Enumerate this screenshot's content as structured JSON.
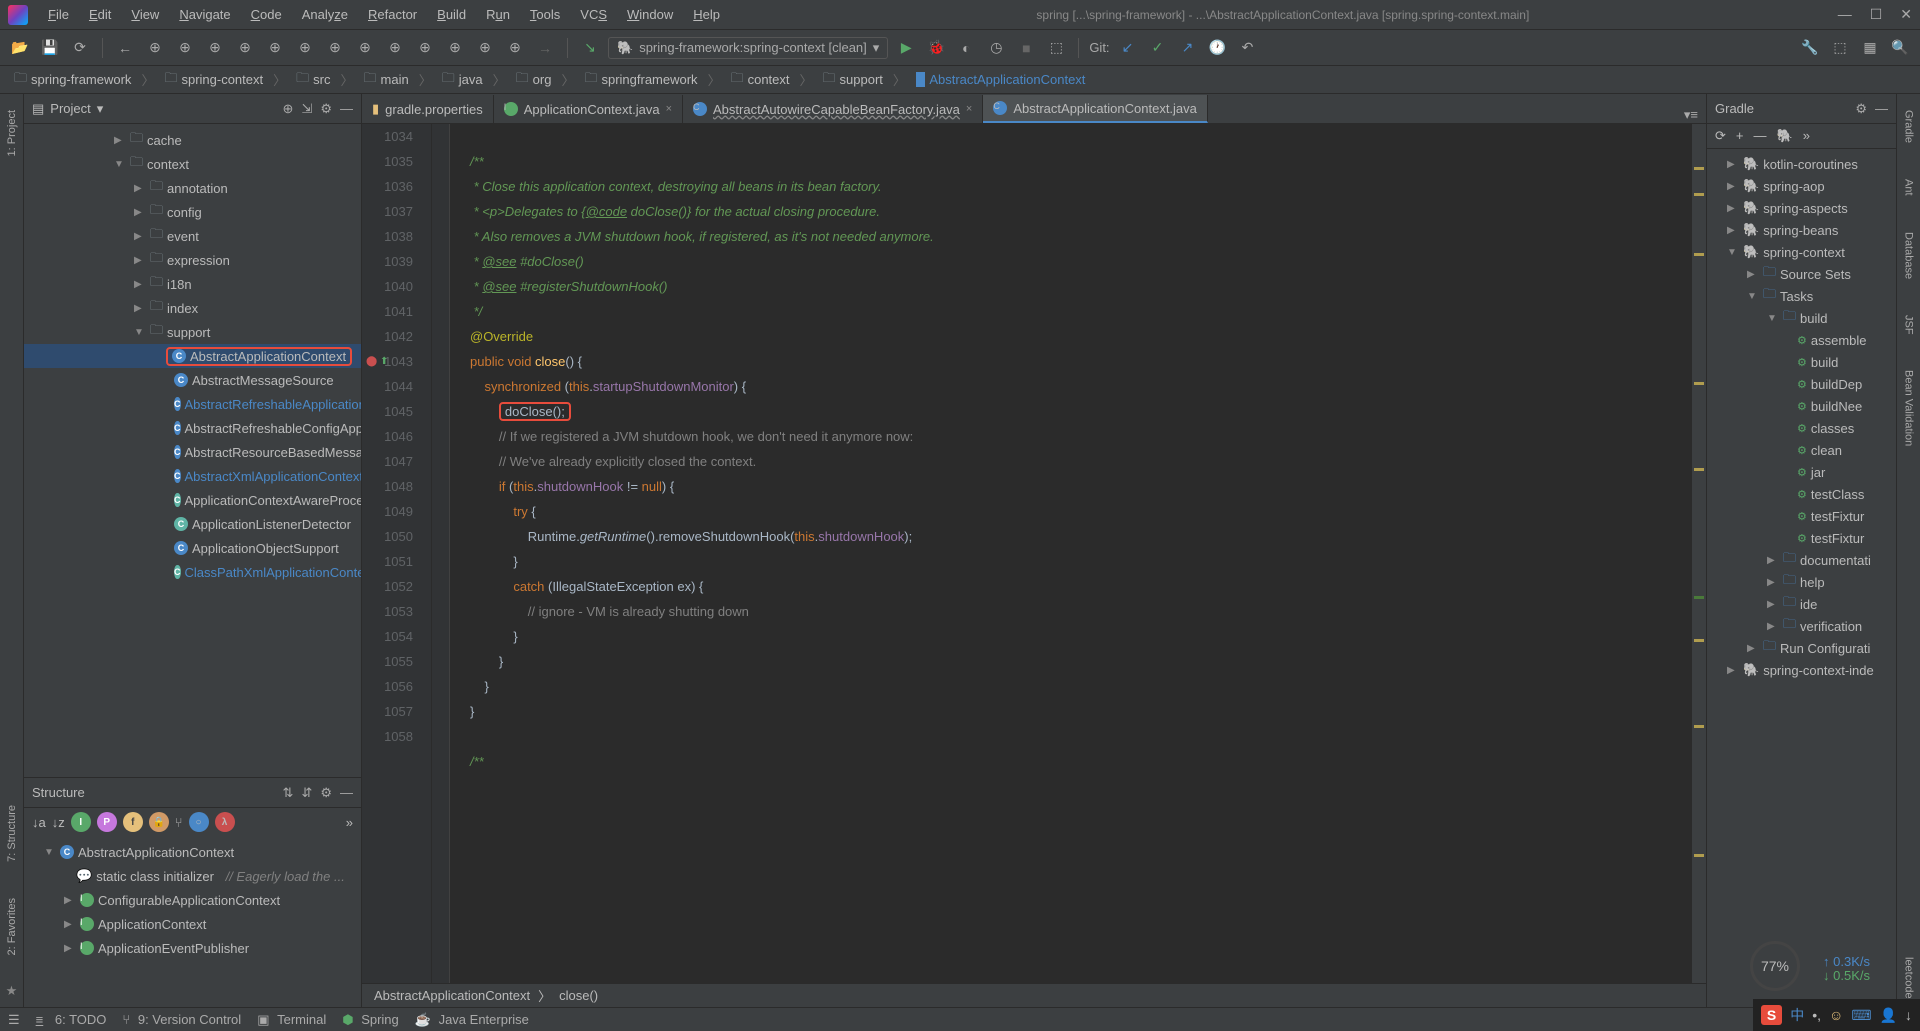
{
  "title": "spring [...\\spring-framework] - ...\\AbstractApplicationContext.java [spring.spring-context.main]",
  "menu": [
    "File",
    "Edit",
    "View",
    "Navigate",
    "Code",
    "Analyze",
    "Refactor",
    "Build",
    "Run",
    "Tools",
    "VCS",
    "Window",
    "Help"
  ],
  "run_config": "spring-framework:spring-context [clean]",
  "git_label": "Git:",
  "breadcrumb": [
    "spring-framework",
    "spring-context",
    "src",
    "main",
    "java",
    "org",
    "springframework",
    "context",
    "support",
    "AbstractApplicationContext"
  ],
  "project_panel_title": "Project",
  "project_tree": {
    "cache": "cache",
    "context": "context",
    "annotation": "annotation",
    "config": "config",
    "event": "event",
    "expression": "expression",
    "i18n": "i18n",
    "index": "index",
    "support": "support",
    "c1": "AbstractApplicationContext",
    "c2": "AbstractMessageSource",
    "c3": "AbstractRefreshableApplicationC",
    "c4": "AbstractRefreshableConfigAppli",
    "c5": "AbstractResourceBasedMessage",
    "c6": "AbstractXmlApplicationContext",
    "c7": "ApplicationContextAwareProces",
    "c8": "ApplicationListenerDetector",
    "c9": "ApplicationObjectSupport",
    "c10": "ClassPathXmlApplicationContex"
  },
  "structure_title": "Structure",
  "structure_items": {
    "s1": "AbstractApplicationContext",
    "s2": "static class initializer",
    "s2c": "// Eagerly load the ...",
    "s3": "ConfigurableApplicationContext",
    "s4": "ApplicationContext",
    "s5": "ApplicationEventPublisher"
  },
  "tabs": [
    {
      "label": "gradle.properties"
    },
    {
      "label": "ApplicationContext.java"
    },
    {
      "label": "AbstractAutowireCapableBeanFactory.java"
    },
    {
      "label": "AbstractApplicationContext.java",
      "active": true
    }
  ],
  "line_start": 1034,
  "code_crumb": {
    "cls": "AbstractApplicationContext",
    "fn": "close()"
  },
  "gradle_title": "Gradle",
  "gradle_tree": [
    "kotlin-coroutines",
    "spring-aop",
    "spring-aspects",
    "spring-beans",
    "spring-context"
  ],
  "gradle_sub": {
    "ss": "Source Sets",
    "tasks": "Tasks",
    "build": "build",
    "t1": "assemble",
    "t2": "build",
    "t3": "buildDep",
    "t4": "buildNee",
    "t5": "classes",
    "t6": "clean",
    "t7": "jar",
    "t8": "testClass",
    "t9": "testFixtur",
    "t10": "testFixtur",
    "doc": "documentati",
    "help": "help",
    "ide": "ide",
    "ver": "verification",
    "rc": "Run Configurati",
    "sci": "spring-context-inde"
  },
  "status": {
    "todo": "6: TODO",
    "vc": "9: Version Control",
    "term": "Terminal",
    "spring": "Spring",
    "je": "Java Enterprise"
  },
  "left_tabs": [
    "1: Project",
    "7: Structure",
    "2: Favorites"
  ],
  "right_tabs": [
    "Gradle",
    "Ant",
    "Database",
    "JSF",
    "Bean Validation",
    "leetcode"
  ],
  "gauge": {
    "pct": "77%",
    "up": "0.3K/s",
    "dn": "0.5K/s"
  }
}
